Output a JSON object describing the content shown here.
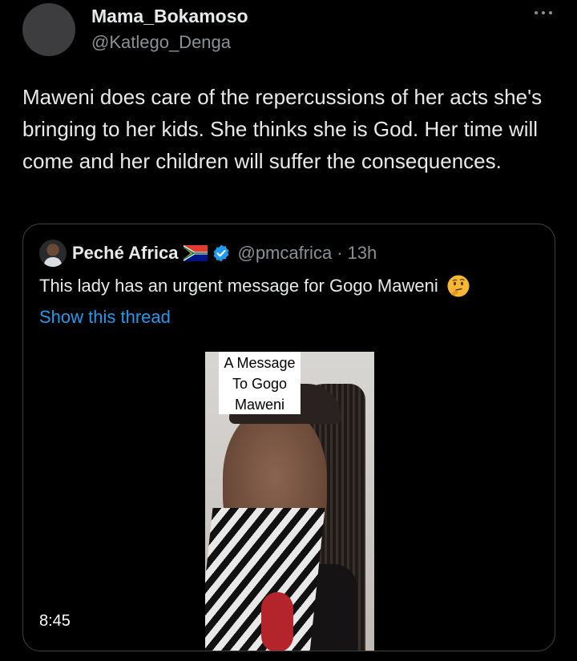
{
  "tweet": {
    "author_name": "Mama_Bokamoso",
    "author_handle": "@Katlego_Denga",
    "text": "Maweni does care of the repercussions of her acts she's bringing to her kids. She thinks she is God. Her time will come and her children will suffer the consequences."
  },
  "quoted": {
    "author_name": "Peché Africa",
    "author_handle": "@pmcafrica",
    "separator": "·",
    "time": "13h",
    "text": "This lady has an urgent message for Gogo Maweni",
    "show_thread_label": "Show this thread",
    "video": {
      "caption_lines": [
        "A Message",
        "To Gogo",
        "Maweni"
      ],
      "duration": "8:45"
    }
  },
  "icons": {
    "more": "more-horizontal-icon",
    "flag": "south-africa-flag-icon",
    "verified": "verified-badge-icon",
    "emoji": "thinking-face-icon"
  },
  "colors": {
    "background": "#000000",
    "text_primary": "#e7e9ea",
    "text_secondary": "#8b9096",
    "link": "#1d9bf0",
    "verified": "#1d9bf0",
    "border": "#3e4144"
  }
}
